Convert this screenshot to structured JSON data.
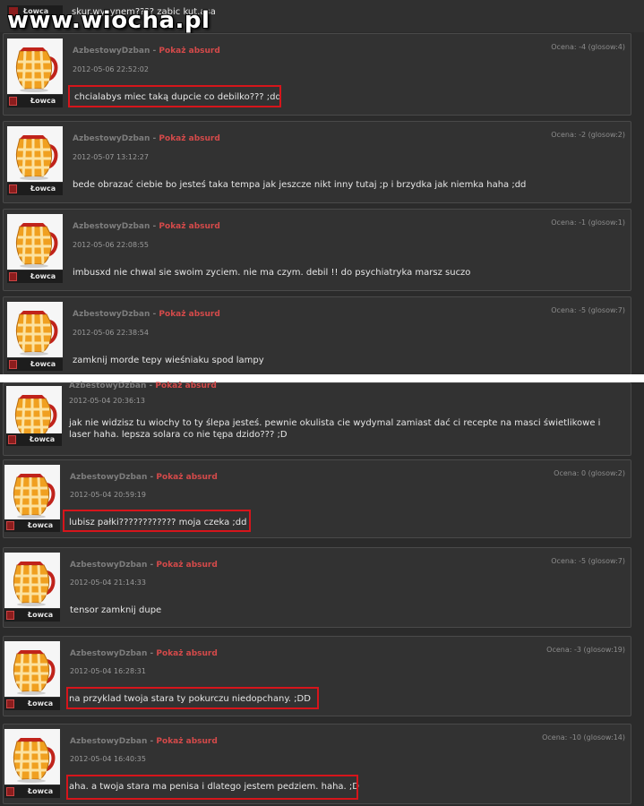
{
  "watermark": "www.wiocha.pl",
  "top_partial": {
    "text": "skur.wysynem???? zabic kut.asa",
    "badge": "Łowca"
  },
  "comments": [
    {
      "user": "AzbestowyDzban",
      "link": "Pokaż absurd",
      "date": "2012-05-06 22:52:02",
      "rating": "Ocena: -4 (glosow:4)",
      "text": "chcialabys miec taką dupcie co debilko??? ;dd",
      "badge": "Łowca"
    },
    {
      "user": "AzbestowyDzban",
      "link": "Pokaż absurd",
      "date": "2012-05-07 13:12:27",
      "rating": "Ocena: -2 (glosow:2)",
      "text": "bede obrazać ciebie bo jesteś taka tempa jak jeszcze nikt inny tutaj ;p i brzydka jak niemka haha ;dd",
      "badge": "Łowca"
    },
    {
      "user": "AzbestowyDzban",
      "link": "Pokaż absurd",
      "date": "2012-05-06 22:08:55",
      "rating": "Ocena: -1 (glosow:1)",
      "text": "imbusxd nie chwal sie swoim zyciem. nie ma czym. debil !! do psychiatryka marsz suczo",
      "badge": "Łowca"
    },
    {
      "user": "AzbestowyDzban",
      "link": "Pokaż absurd",
      "date": "2012-05-06 22:38:54",
      "rating": "Ocena: -5 (glosow:7)",
      "text": "zamknij morde tepy wieśniaku spod lampy",
      "badge": "Łowca"
    },
    {
      "user": "AzbestowyDzban",
      "link": "Pokaż absurd",
      "date": "2012-05-04 20:36:13",
      "rating": "",
      "text": "jak nie widzisz tu wiochy to ty ślepa jesteś. pewnie okulista cie wydymal zamiast dać ci recepte na masci świetlikowe i laser haha. lepsza solara co nie tępa dzido??? ;D",
      "badge": "Łowca"
    },
    {
      "user": "AzbestowyDzban",
      "link": "Pokaż absurd",
      "date": "2012-05-04 20:59:19",
      "rating": "Ocena: 0 (glosow:2)",
      "text": "lubisz pałki???????????? moja czeka ;dd",
      "badge": "Łowca"
    },
    {
      "user": "AzbestowyDzban",
      "link": "Pokaż absurd",
      "date": "2012-05-04 21:14:33",
      "rating": "Ocena: -5 (glosow:7)",
      "text": "tensor zamknij dupe",
      "badge": "Łowca"
    },
    {
      "user": "AzbestowyDzban",
      "link": "Pokaż absurd",
      "date": "2012-05-04 16:28:31",
      "rating": "Ocena: -3 (glosow:19)",
      "text": "na przyklad twoja stara ty pokurczu niedopchany. ;DD",
      "badge": "Łowca"
    },
    {
      "user": "AzbestowyDzban",
      "link": "Pokaż absurd",
      "date": "2012-05-04 16:40:35",
      "rating": "Ocena: -10 (glosow:14)",
      "text": "aha. a twoja stara ma penisa i dlatego jestem pedziem. haha. ;D",
      "badge": "Łowca"
    }
  ],
  "colors": {
    "background": "#2b2b2b",
    "panel": "#323232",
    "link": "#d44a4a",
    "highlight": "#d6151b"
  }
}
